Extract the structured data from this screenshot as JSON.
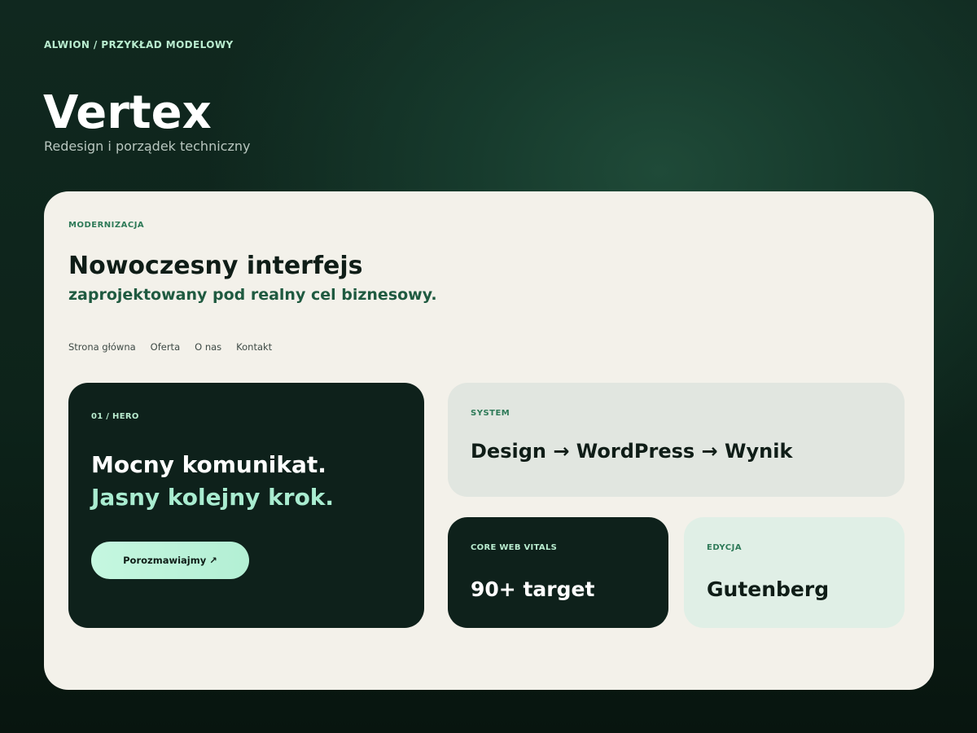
{
  "header": {
    "eyebrow": "ALWION / PRZYKŁAD MODELOWY",
    "title": "Vertex",
    "subtitle": "Redesign i porządek techniczny"
  },
  "card": {
    "eyebrow": "MODERNIZACJA",
    "title": "Nowoczesny interfejs",
    "subtitle": "zaprojektowany pod realny cel biznesowy.",
    "nav": [
      "Strona główna",
      "Oferta",
      "O nas",
      "Kontakt"
    ]
  },
  "hero": {
    "tag": "01 / HERO",
    "line1": "Mocny komunikat.",
    "line2": "Jasny kolejny krok.",
    "cta_label": "Porozmawiajmy",
    "cta_icon": "↗"
  },
  "system": {
    "tag": "SYSTEM",
    "text": "Design → WordPress → Wynik"
  },
  "cwv": {
    "tag": "CORE WEB VITALS",
    "text": "90+ target"
  },
  "edit": {
    "tag": "EDYCJA",
    "text": "Gutenberg"
  },
  "colors": {
    "background": "#10281f",
    "card": "#f3f1ea",
    "dark_tile": "#0e211b",
    "accent_mint": "#b9eccf",
    "accent_green": "#2e7a58"
  }
}
